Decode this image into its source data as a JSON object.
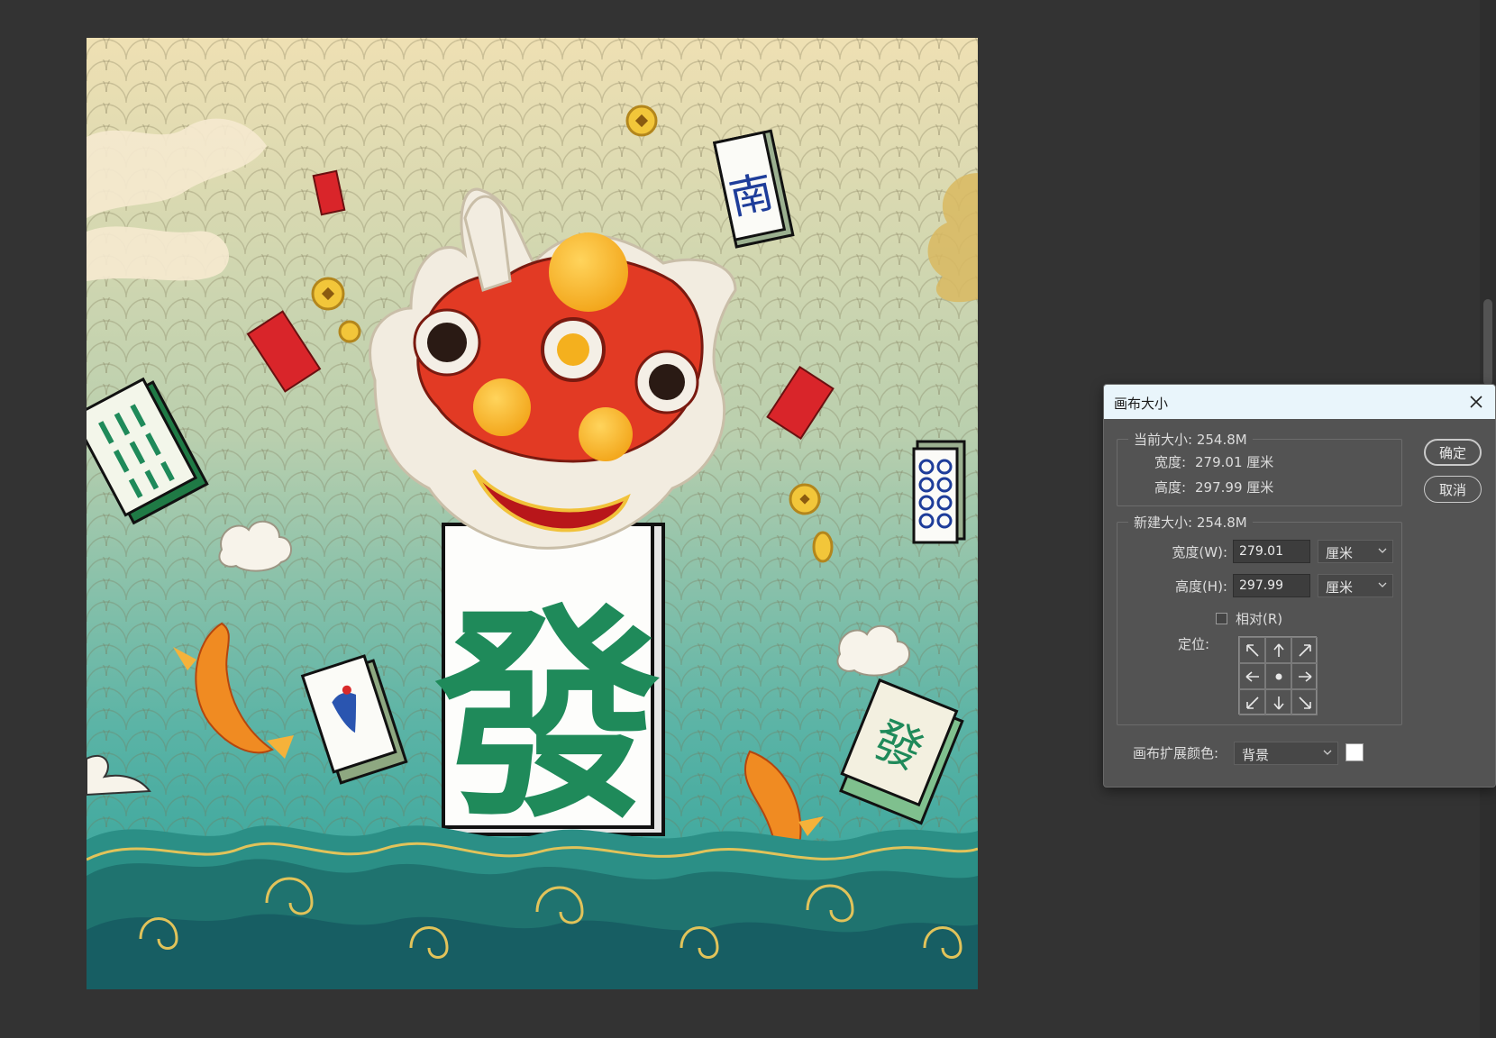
{
  "dialog": {
    "title": "画布大小",
    "current_size": {
      "legend": "当前大小: 254.8M",
      "width_label": "宽度:",
      "width_value": "279.01 厘米",
      "height_label": "高度:",
      "height_value": "297.99 厘米"
    },
    "new_size": {
      "legend": "新建大小: 254.8M",
      "width_label": "宽度(W):",
      "width_value": "279.01",
      "width_unit": "厘米",
      "height_label": "高度(H):",
      "height_value": "297.99",
      "height_unit": "厘米",
      "relative_label": "相对(R)",
      "relative_checked": false,
      "anchor_label": "定位:"
    },
    "extension_color_label": "画布扩展颜色:",
    "extension_color_value": "背景",
    "extension_swatch_color": "#ffffff",
    "ok_label": "确定",
    "cancel_label": "取消"
  },
  "artwork": {
    "center_tile_char": "發",
    "south_tile_char": "南",
    "colors": {
      "sky_top": "#efe0b3",
      "sea_bottom": "#239d97",
      "wave_dark": "#175e63",
      "gold": "#e1c35a",
      "tile_green": "#1f8a5a",
      "lion_red": "#e23a24"
    }
  }
}
